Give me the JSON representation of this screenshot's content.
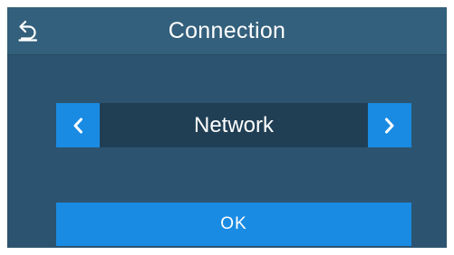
{
  "header": {
    "title": "Connection",
    "back_icon": "back-arrow-icon"
  },
  "selector": {
    "value": "Network",
    "prev_icon": "chevron-left-icon",
    "next_icon": "chevron-right-icon"
  },
  "actions": {
    "ok_label": "OK"
  },
  "colors": {
    "screen_background": "#2c5470",
    "header_background": "#33607c",
    "selector_background": "#203f55",
    "accent": "#1a8be3",
    "text": "#ffffff"
  }
}
